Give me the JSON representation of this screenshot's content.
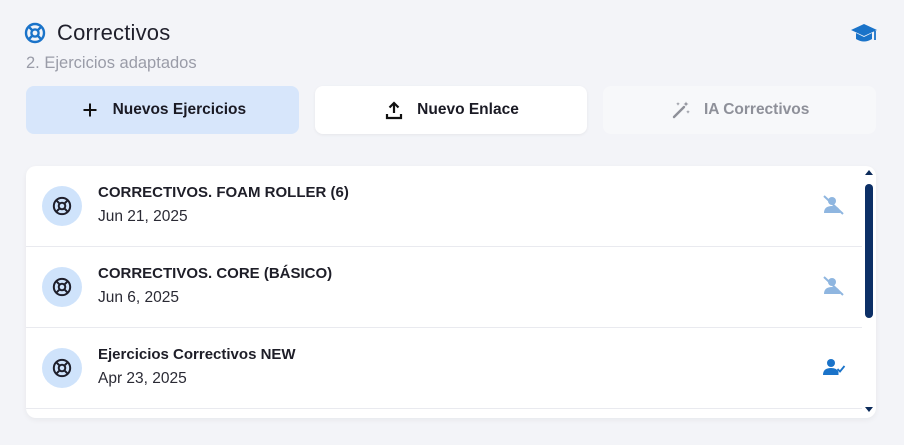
{
  "header": {
    "title": "Correctivos",
    "subtitle": "2. Ejercicios adaptados",
    "title_icon": "lifebuoy-icon",
    "right_icon": "graduation-cap-icon"
  },
  "actions": [
    {
      "label": "Nuevos Ejercicios",
      "icon": "plus-icon",
      "state": "selected"
    },
    {
      "label": "Nuevo Enlace",
      "icon": "upload-icon",
      "state": "normal"
    },
    {
      "label": "IA Correctivos",
      "icon": "magic-wand-icon",
      "state": "disabled"
    }
  ],
  "items": [
    {
      "title": "CORRECTIVOS. FOAM ROLLER (6)",
      "date": "Jun 21, 2025",
      "icon": "lifebuoy-icon",
      "status_icon": "user-off-icon"
    },
    {
      "title": "CORRECTIVOS. CORE (BÁSICO)",
      "date": "Jun 6, 2025",
      "icon": "lifebuoy-icon",
      "status_icon": "user-off-icon"
    },
    {
      "title": "Ejercicios Correctivos NEW",
      "date": "Apr 23, 2025",
      "icon": "lifebuoy-icon",
      "status_icon": "user-check-icon"
    }
  ],
  "colors": {
    "accent": "#1a73c9",
    "muted_icon": "#8fb6e0",
    "primary_button": "#d7e6fb",
    "scrollbar": "#0c2f66"
  }
}
